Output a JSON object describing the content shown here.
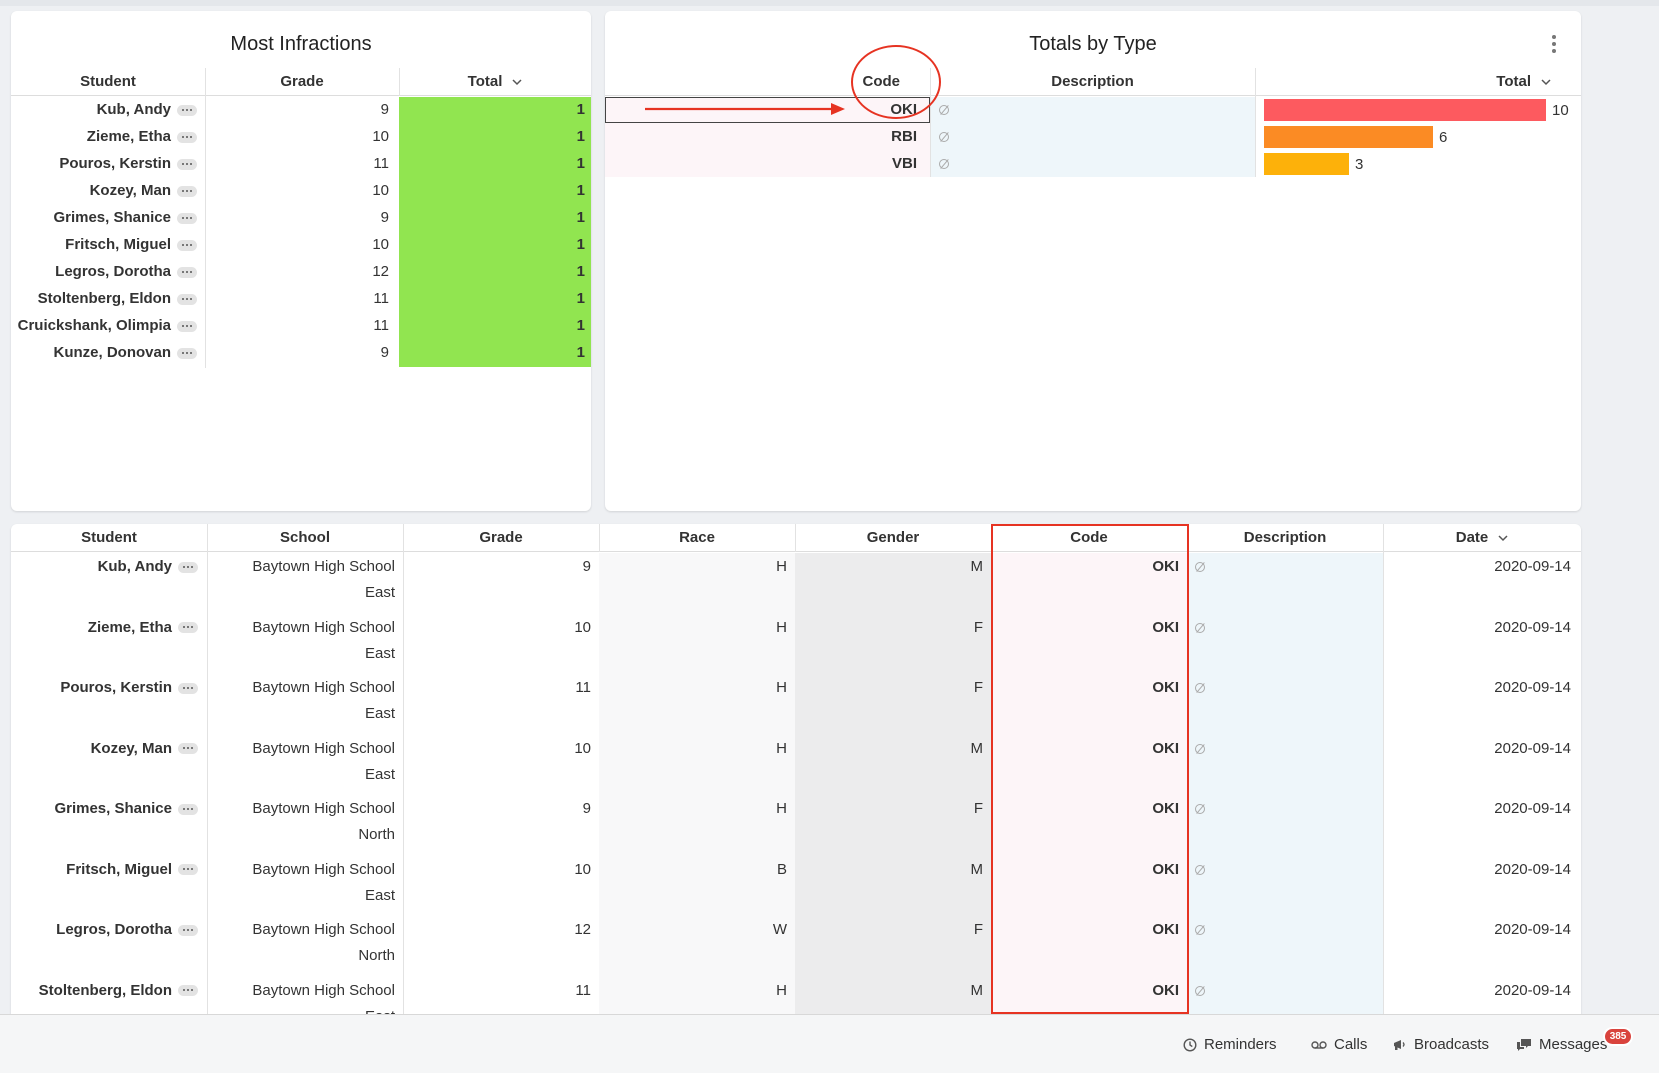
{
  "most_infractions": {
    "title": "Most Infractions",
    "headers": {
      "student": "Student",
      "grade": "Grade",
      "total": "Total"
    },
    "rows": [
      {
        "student": "Kub, Andy",
        "grade": "9",
        "total": "1"
      },
      {
        "student": "Zieme, Etha",
        "grade": "10",
        "total": "1"
      },
      {
        "student": "Pouros, Kerstin",
        "grade": "11",
        "total": "1"
      },
      {
        "student": "Kozey, Man",
        "grade": "10",
        "total": "1"
      },
      {
        "student": "Grimes, Shanice",
        "grade": "9",
        "total": "1"
      },
      {
        "student": "Fritsch, Miguel",
        "grade": "10",
        "total": "1"
      },
      {
        "student": "Legros, Dorotha",
        "grade": "12",
        "total": "1"
      },
      {
        "student": "Stoltenberg, Eldon",
        "grade": "11",
        "total": "1"
      },
      {
        "student": "Cruickshank, Olimpia",
        "grade": "11",
        "total": "1"
      },
      {
        "student": "Kunze, Donovan",
        "grade": "9",
        "total": "1"
      }
    ]
  },
  "totals_by_type": {
    "title": "Totals by Type",
    "headers": {
      "code": "Code",
      "description": "Description",
      "total": "Total"
    },
    "rows": [
      {
        "code": "OKI",
        "total": 10,
        "color": "#fd5a5f"
      },
      {
        "code": "RBI",
        "total": 6,
        "color": "#fb8b24"
      },
      {
        "code": "VBI",
        "total": 3,
        "color": "#fdb10a"
      }
    ],
    "max_total": 10
  },
  "detail": {
    "headers": {
      "student": "Student",
      "school": "School",
      "grade": "Grade",
      "race": "Race",
      "gender": "Gender",
      "code": "Code",
      "description": "Description",
      "date": "Date"
    },
    "rows": [
      {
        "student": "Kub, Andy",
        "school1": "Baytown High School",
        "school2": "East",
        "grade": "9",
        "race": "H",
        "gender": "M",
        "code": "OKI",
        "date": "2020-09-14"
      },
      {
        "student": "Zieme, Etha",
        "school1": "Baytown High School",
        "school2": "East",
        "grade": "10",
        "race": "H",
        "gender": "F",
        "code": "OKI",
        "date": "2020-09-14"
      },
      {
        "student": "Pouros, Kerstin",
        "school1": "Baytown High School",
        "school2": "East",
        "grade": "11",
        "race": "H",
        "gender": "F",
        "code": "OKI",
        "date": "2020-09-14"
      },
      {
        "student": "Kozey, Man",
        "school1": "Baytown High School",
        "school2": "East",
        "grade": "10",
        "race": "H",
        "gender": "M",
        "code": "OKI",
        "date": "2020-09-14"
      },
      {
        "student": "Grimes, Shanice",
        "school1": "Baytown High School",
        "school2": "North",
        "grade": "9",
        "race": "H",
        "gender": "F",
        "code": "OKI",
        "date": "2020-09-14"
      },
      {
        "student": "Fritsch, Miguel",
        "school1": "Baytown High School",
        "school2": "East",
        "grade": "10",
        "race": "B",
        "gender": "M",
        "code": "OKI",
        "date": "2020-09-14"
      },
      {
        "student": "Legros, Dorotha",
        "school1": "Baytown High School",
        "school2": "North",
        "grade": "12",
        "race": "W",
        "gender": "F",
        "code": "OKI",
        "date": "2020-09-14"
      },
      {
        "student": "Stoltenberg, Eldon",
        "school1": "Baytown High School",
        "school2": "East",
        "grade": "11",
        "race": "H",
        "gender": "M",
        "code": "OKI",
        "date": "2020-09-14"
      }
    ]
  },
  "footer": {
    "reminders": "Reminders",
    "calls": "Calls",
    "broadcasts": "Broadcasts",
    "messages": "Messages",
    "messages_badge": "385"
  },
  "colors": {
    "annotation": "#e63322",
    "green_total": "#91e550"
  }
}
